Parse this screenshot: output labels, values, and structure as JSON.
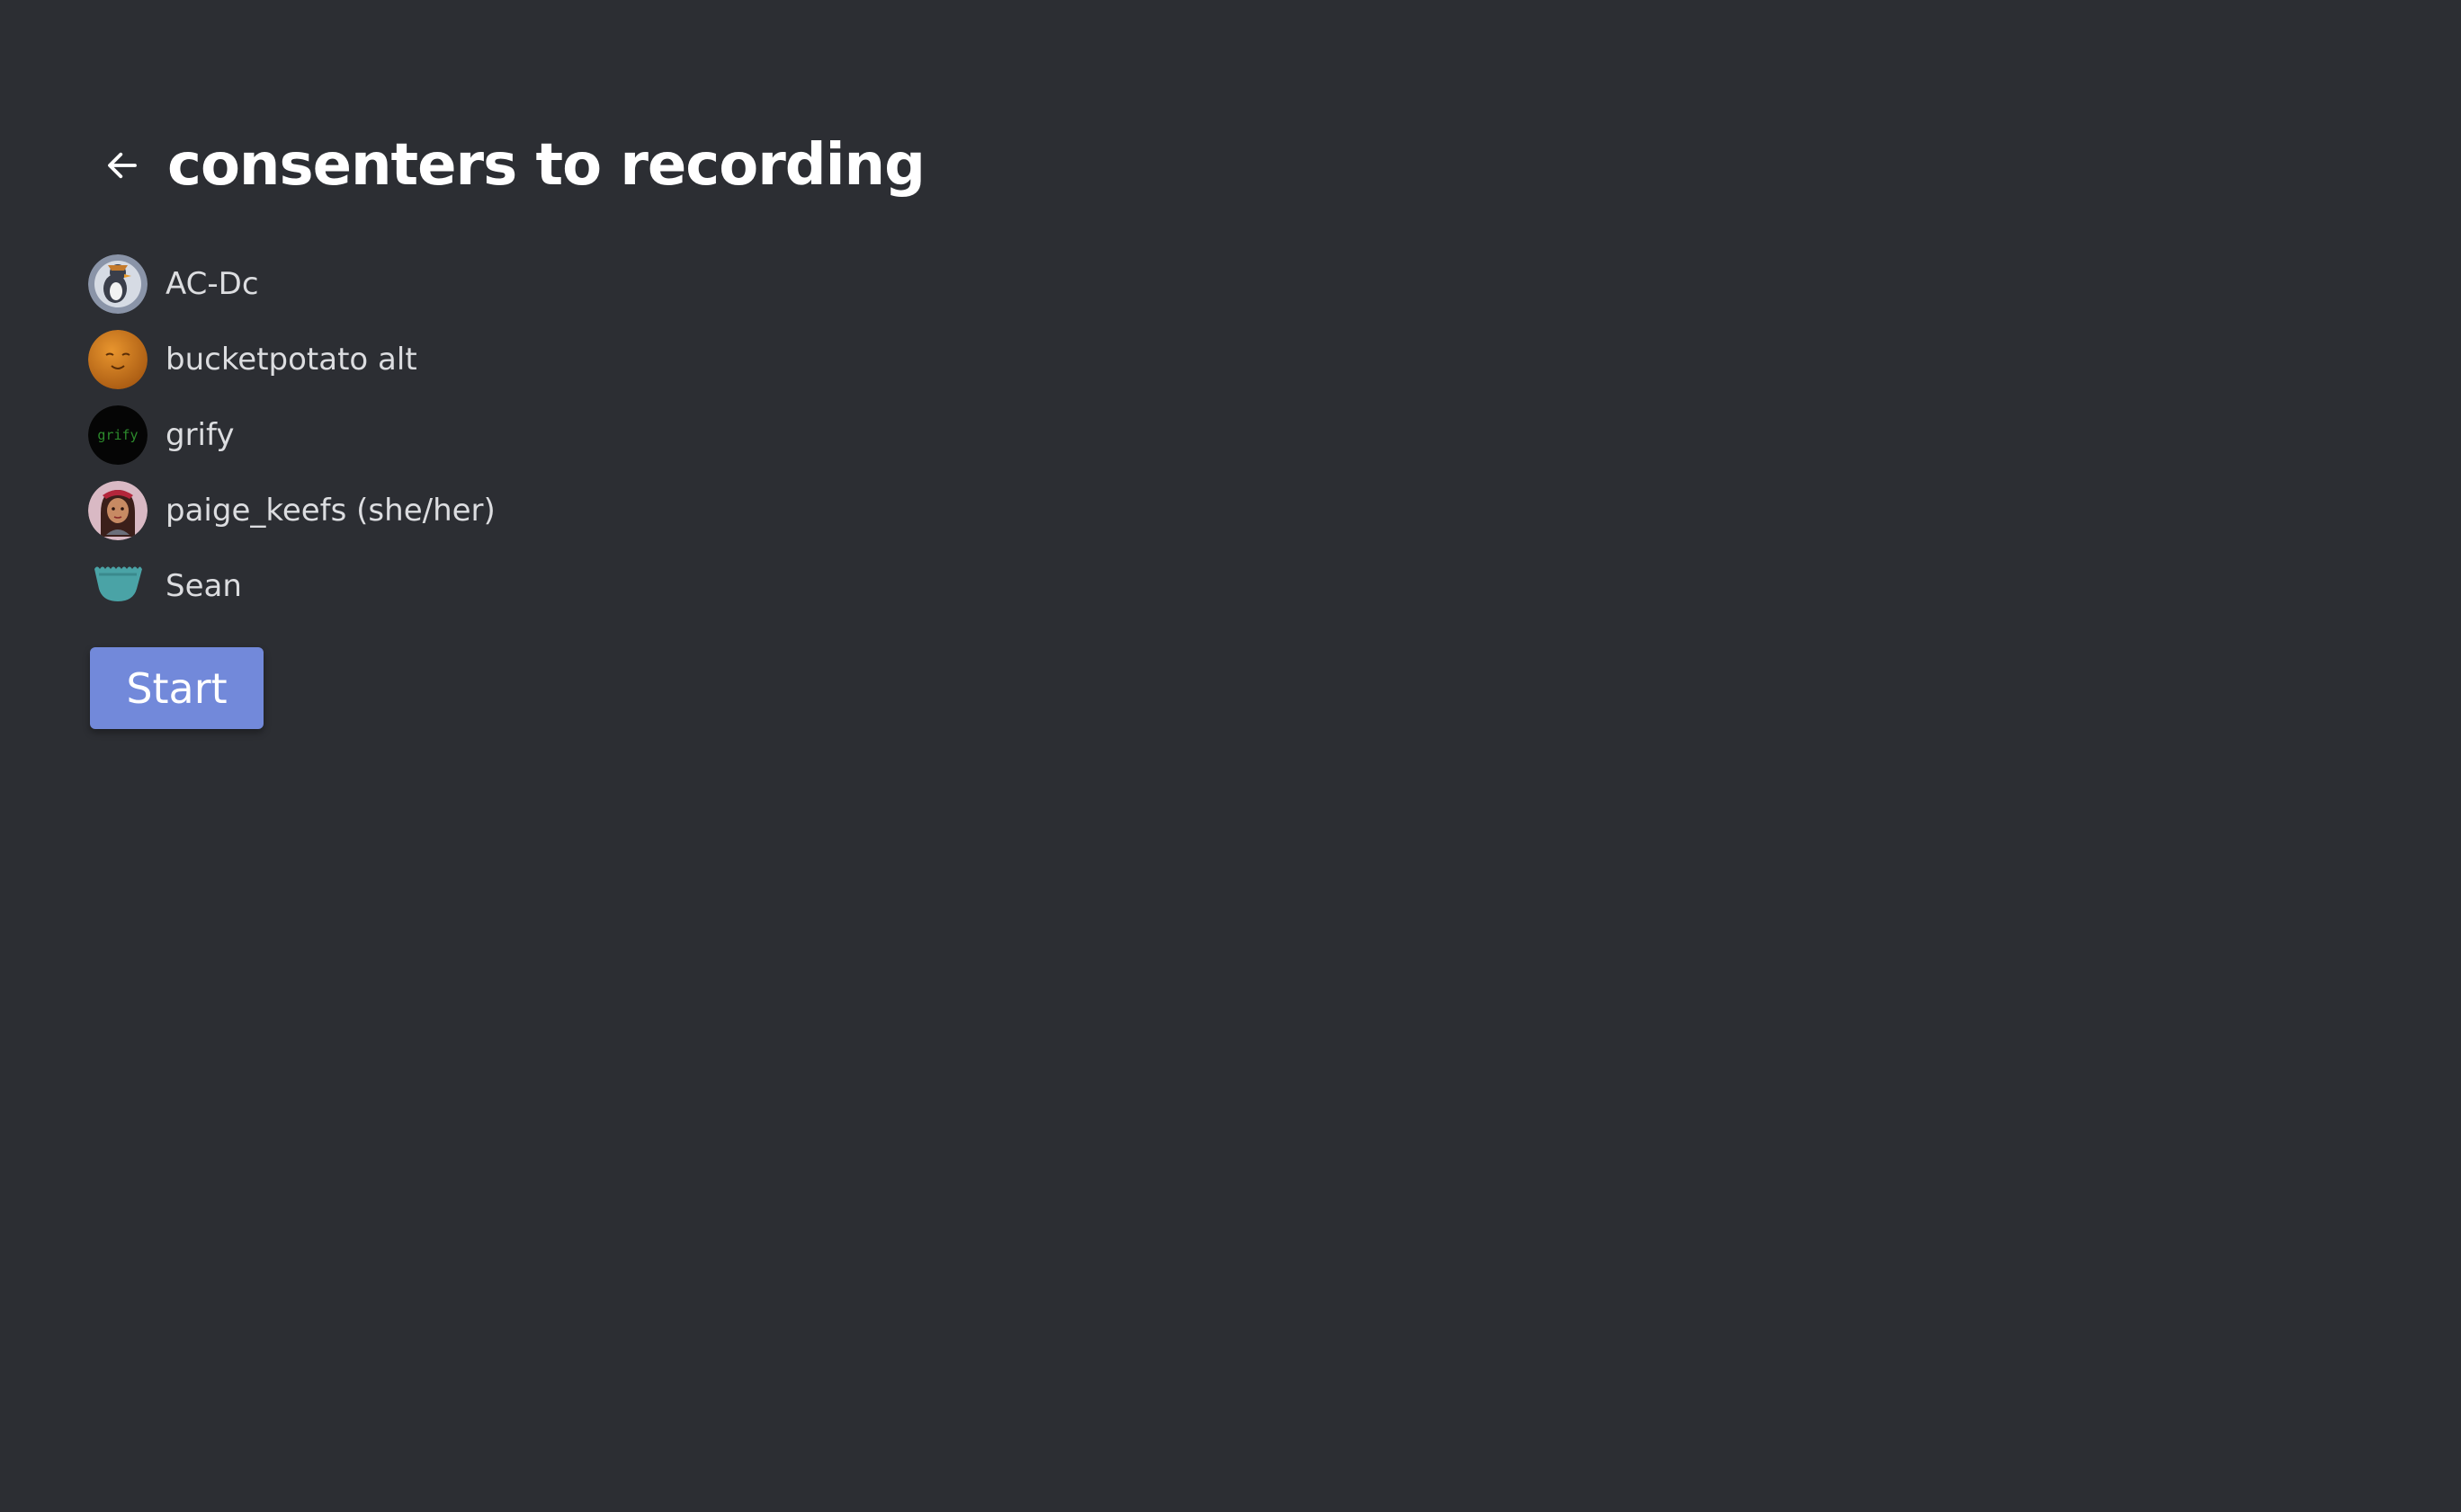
{
  "header": {
    "back_icon": "arrow-left-icon",
    "title": "consenters to recording"
  },
  "users": [
    {
      "name": "AC-Dc",
      "avatar": "penguin-avatar"
    },
    {
      "name": "bucketpotato alt",
      "avatar": "orange-smiley-avatar"
    },
    {
      "name": "grify",
      "avatar": "grify-text-avatar"
    },
    {
      "name": "paige_keefs (she/her)",
      "avatar": "illustrated-woman-avatar"
    },
    {
      "name": "Sean",
      "avatar": "teal-cup-avatar"
    }
  ],
  "start_button": {
    "label": "Start"
  },
  "colors": {
    "background": "#2c2e33",
    "accent": "#7289da",
    "title": "#ffffff",
    "text": "#dcdde0"
  }
}
